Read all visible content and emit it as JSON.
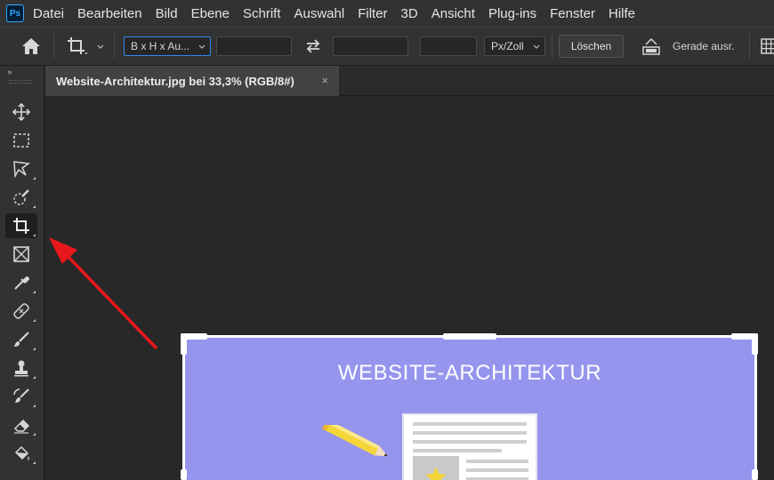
{
  "app": {
    "logo": "Ps"
  },
  "menu": [
    "Datei",
    "Bearbeiten",
    "Bild",
    "Ebene",
    "Schrift",
    "Auswahl",
    "Filter",
    "3D",
    "Ansicht",
    "Plug-ins",
    "Fenster",
    "Hilfe"
  ],
  "options": {
    "ratio_preset": "B x H x Au...",
    "width_value": "",
    "height_value": "",
    "resolution_value": "",
    "unit_select": "Px/Zoll",
    "clear_button": "Löschen",
    "straighten_label": "Gerade ausr."
  },
  "toolbar": {
    "collapse": "»",
    "tools": [
      "move-tool",
      "marquee-tool",
      "lasso-tool",
      "quick-selection-tool",
      "crop-tool",
      "frame-tool",
      "eyedropper-tool",
      "healing-brush-tool",
      "brush-tool",
      "clone-stamp-tool",
      "history-brush-tool",
      "eraser-tool",
      "paint-bucket-tool"
    ],
    "selected_tool": "crop-tool"
  },
  "document": {
    "tab_title": "Website-Architektur.jpg bei 33,3% (RGB/8#)",
    "tab_close": "×",
    "image_title": "WEBSITE-ARCHITEKTUR"
  },
  "colors": {
    "image_background": "#9595ee",
    "annotation_arrow": "#e8171c",
    "focus_accent": "#2d8ceb"
  }
}
